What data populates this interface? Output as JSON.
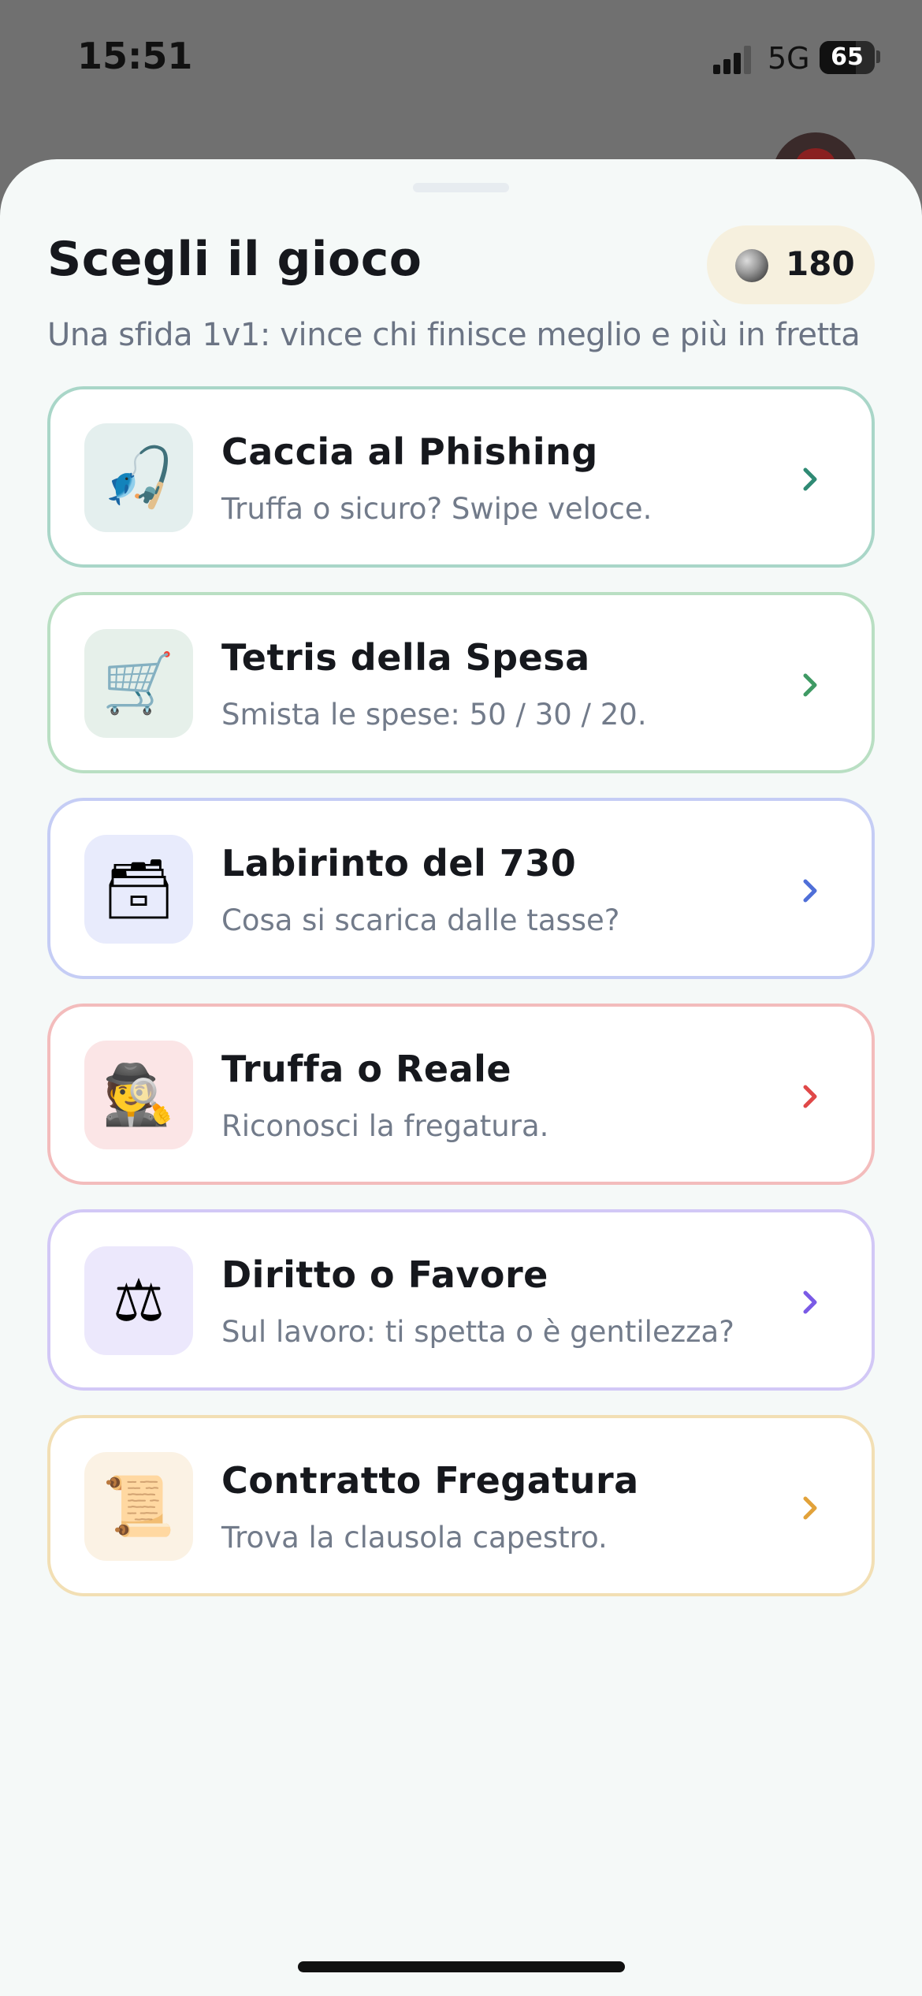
{
  "status_bar": {
    "time": "15:51",
    "network": "5G",
    "battery": "65",
    "battery_level": 0.65
  },
  "sheet": {
    "title": "Scegli il gioco",
    "subtitle": "Una sfida 1v1: vince chi finisce meglio e più in fretta",
    "coins": "180",
    "coin_icon": "silver-coin-icon"
  },
  "games": [
    {
      "title": "Caccia al Phishing",
      "description": "Truffa o sicuro? Swipe veloce.",
      "emoji": "🎣",
      "icon": "fishing-rod-icon",
      "accent": "#2f8a74",
      "border": "#a9d6c8",
      "tile_bg": "#e4efee"
    },
    {
      "title": "Tetris della Spesa",
      "description": "Smista le spese: 50 / 30 / 20.",
      "emoji": "🛒",
      "icon": "shopping-cart-icon",
      "accent": "#3f9a64",
      "border": "#b9dfc3",
      "tile_bg": "#e6f0ea"
    },
    {
      "title": "Labirinto del 730",
      "description": "Cosa si scarica dalle tasse?",
      "emoji": "🗃",
      "icon": "card-file-box-icon",
      "accent": "#4f6fd8",
      "border": "#c5cdf5",
      "tile_bg": "#e8ebfc"
    },
    {
      "title": "Truffa o Reale",
      "description": "Riconosci la fregatura.",
      "emoji": "🕵",
      "icon": "detective-icon",
      "accent": "#e04848",
      "border": "#f3bcbc",
      "tile_bg": "#fbe5e6"
    },
    {
      "title": "Diritto o Favore",
      "description": "Sul lavoro: ti spetta o è gentilezza?",
      "emoji": "⚖",
      "icon": "balance-scale-icon",
      "accent": "#7a5ae6",
      "border": "#d2c8f6",
      "tile_bg": "#ece8fc"
    },
    {
      "title": "Contratto Fregatura",
      "description": "Trova la clausola capestro.",
      "emoji": "📜",
      "icon": "scroll-icon",
      "accent": "#e2a23a",
      "border": "#f2dfb4",
      "tile_bg": "#fbf2e4"
    }
  ]
}
